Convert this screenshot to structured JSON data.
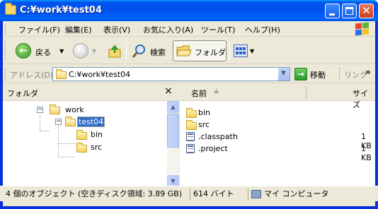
{
  "window": {
    "title": "C:¥work¥test04"
  },
  "menu": {
    "items": [
      {
        "label": "ファイル(F)"
      },
      {
        "label": "編集(E)"
      },
      {
        "label": "表示(V)"
      },
      {
        "label": "お気に入り(A)"
      },
      {
        "label": "ツール(T)"
      },
      {
        "label": "ヘルプ(H)"
      }
    ]
  },
  "toolbar": {
    "back_label": "戻る",
    "search_label": "検索",
    "folders_label": "フォルダ"
  },
  "address": {
    "label": "アドレス(D)",
    "value": "C:¥work¥test04",
    "go_label": "移動",
    "links_label": "リンク"
  },
  "folder_pane": {
    "title": "フォルダ",
    "close_glyph": "×",
    "tree": [
      {
        "label": "work",
        "expander": "−",
        "selected": false
      },
      {
        "label": "test04",
        "expander": "−",
        "selected": true
      },
      {
        "label": "bin",
        "selected": false
      },
      {
        "label": "src",
        "selected": false
      }
    ]
  },
  "file_list": {
    "col_name": "名前",
    "col_size": "サイズ",
    "files": [
      {
        "name": "bin",
        "size": "",
        "icon": "folder-icon"
      },
      {
        "name": "src",
        "size": "",
        "icon": "folder-icon"
      },
      {
        "name": ".classpath",
        "size": "1 KB",
        "icon": "document-icon"
      },
      {
        "name": ".project",
        "size": "1 KB",
        "icon": "document-icon"
      }
    ]
  },
  "status": {
    "objects": "4 個のオブジェクト (空きディスク領域: 3.89 GB)",
    "size": "614 バイト",
    "location": "マイ コンピュータ"
  },
  "colors": {
    "title_bar": "#0053ee",
    "selection": "#316ac5",
    "chrome": "#ece9d8"
  }
}
